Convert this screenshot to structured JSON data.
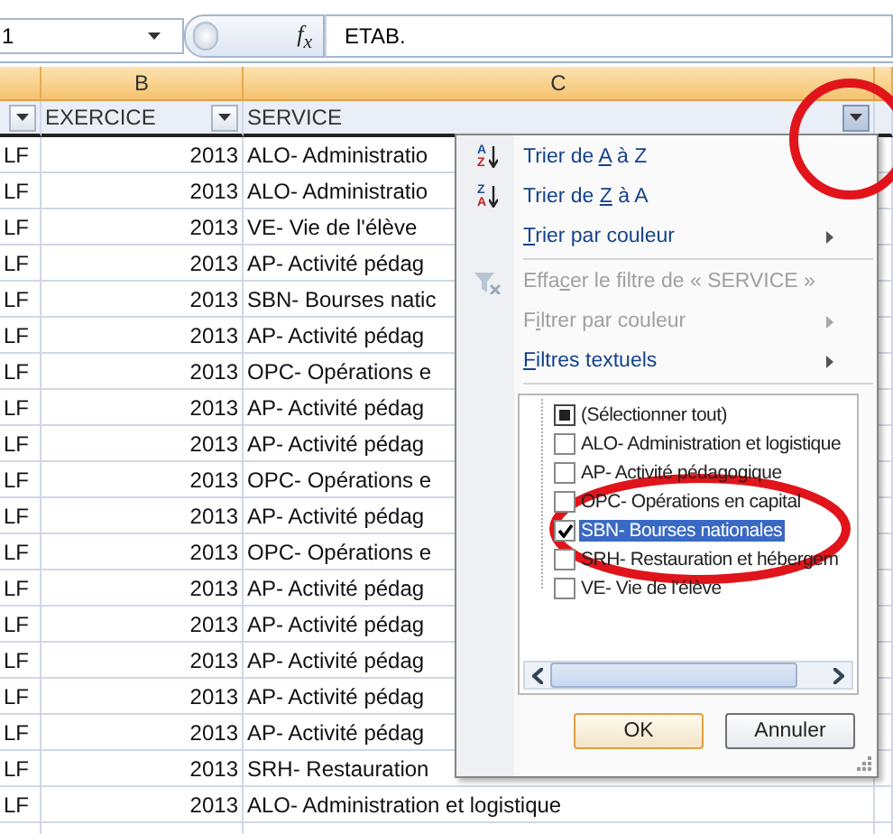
{
  "formula_bar": {
    "name_box": "1",
    "function_label": "f$_{x}$",
    "formula": "ETAB."
  },
  "column_headers": [
    {
      "letter": "B"
    },
    {
      "letter": "C"
    }
  ],
  "header_row": [
    {
      "filter_button": true,
      "pressed": false
    },
    {
      "text": "EXERCICE",
      "filter_button": true,
      "pressed": false
    },
    {
      "text": "SERVICE",
      "filter_button": true,
      "pressed": true
    }
  ],
  "rows": [
    [
      "LF",
      "2013",
      "ALO- Administratio"
    ],
    [
      "LF",
      "2013",
      "ALO- Administratio"
    ],
    [
      "LF",
      "2013",
      "VE- Vie de l'élève"
    ],
    [
      "LF",
      "2013",
      "AP- Activité pédag"
    ],
    [
      "LF",
      "2013",
      "SBN- Bourses natic"
    ],
    [
      "LF",
      "2013",
      "AP- Activité pédag"
    ],
    [
      "LF",
      "2013",
      "OPC- Opérations e"
    ],
    [
      "LF",
      "2013",
      "AP- Activité pédag"
    ],
    [
      "LF",
      "2013",
      "AP- Activité pédag"
    ],
    [
      "LF",
      "2013",
      "OPC- Opérations e"
    ],
    [
      "LF",
      "2013",
      "AP- Activité pédag"
    ],
    [
      "LF",
      "2013",
      "OPC- Opérations e"
    ],
    [
      "LF",
      "2013",
      "AP- Activité pédag"
    ],
    [
      "LF",
      "2013",
      "AP- Activité pédag"
    ],
    [
      "LF",
      "2013",
      "AP- Activité pédag"
    ],
    [
      "LF",
      "2013",
      "AP- Activité pédag"
    ],
    [
      "LF",
      "2013",
      "AP- Activité pédag"
    ],
    [
      "LF",
      "2013",
      "SRH- Restauration"
    ],
    [
      "LF",
      "2013",
      "ALO- Administration et logistique"
    ]
  ],
  "filter_menu": {
    "items": [
      {
        "kind": "command",
        "icon": {
          "kind": "sort",
          "top": "A",
          "bottom": "Z"
        },
        "prefix": "Trier de ",
        "key": "A",
        "suffix": " à Z",
        "disabled": false,
        "submenu": false
      },
      {
        "kind": "command",
        "icon": {
          "kind": "sort",
          "top": "Z",
          "bottom": "A"
        },
        "prefix": "Trier de ",
        "key": "Z",
        "suffix": " à A",
        "disabled": false,
        "submenu": false
      },
      {
        "kind": "command",
        "key": "T",
        "suffix": "rier par couleur",
        "disabled": false,
        "submenu": true
      },
      {
        "kind": "separator"
      },
      {
        "kind": "command",
        "icon": {
          "kind": "clear-filter"
        },
        "prefix": "Effa",
        "key": "c",
        "suffix": "er le filtre de « SERVICE »",
        "disabled": true,
        "submenu": false
      },
      {
        "kind": "command",
        "prefix": "F",
        "key": "i",
        "suffix": "ltrer par couleur",
        "disabled": true,
        "submenu": true
      },
      {
        "kind": "command",
        "key": "F",
        "suffix": "iltres textuels",
        "disabled": false,
        "submenu": true
      },
      {
        "kind": "separator"
      }
    ],
    "values": [
      {
        "label": "(Sélectionner tout)",
        "checked": false,
        "partial": true,
        "selected": false
      },
      {
        "label": "ALO- Administration et logistique",
        "checked": false,
        "partial": false,
        "selected": false
      },
      {
        "label": "AP- Activité pédagogique",
        "checked": false,
        "partial": false,
        "selected": false
      },
      {
        "label": "OPC- Opérations en capital",
        "checked": false,
        "partial": false,
        "selected": false
      },
      {
        "label": "SBN- Bourses nationales",
        "checked": true,
        "partial": false,
        "selected": true
      },
      {
        "label": "SRH- Restauration et hébergem",
        "checked": false,
        "partial": false,
        "selected": false
      },
      {
        "label": "VE- Vie de l'élève",
        "checked": false,
        "partial": false,
        "selected": false
      }
    ],
    "buttons": [
      {
        "label": "OK",
        "default": true
      },
      {
        "label": "Annuler",
        "default": false
      }
    ]
  },
  "annotations": [
    {
      "kind": "circle"
    },
    {
      "kind": "ellipse"
    }
  ]
}
